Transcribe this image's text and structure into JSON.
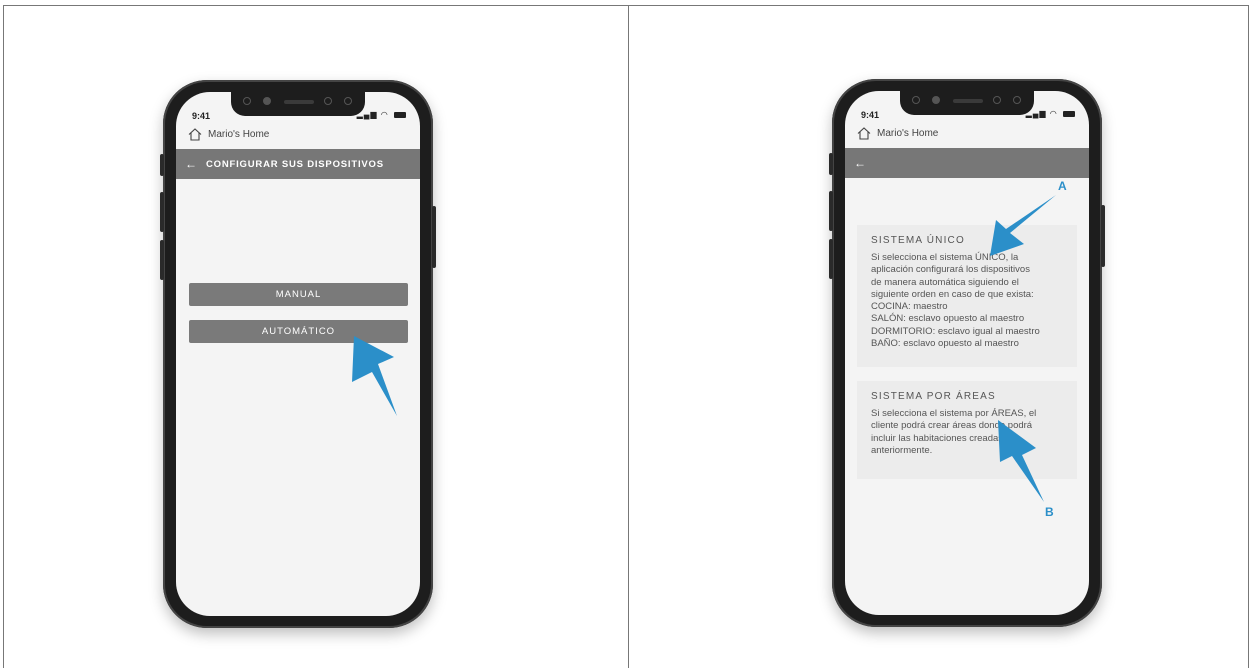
{
  "left_phone": {
    "status_time": "9:41",
    "home_label": "Mario's Home",
    "appbar": {
      "back_icon": "arrow-left-icon",
      "title": "CONFIGURAR SUS DISPOSITIVOS"
    },
    "buttons": {
      "manual": "MANUAL",
      "auto": "AUTOMÁTICO"
    }
  },
  "right_phone": {
    "status_time": "9:41",
    "home_label": "Mario's Home",
    "appbar": {
      "back_icon": "arrow-left-icon"
    },
    "cards": [
      {
        "title": "SISTEMA ÚNICO",
        "lines": [
          "Si selecciona el sistema ÚNICO, la",
          "aplicación configurará los dispositivos",
          "de manera automática siguiendo el",
          "siguiente orden en caso de que exista:",
          "COCINA: maestro",
          "SALÓN: esclavo opuesto al maestro",
          "DORMITORIO: esclavo igual al maestro",
          "BAÑO: esclavo opuesto al maestro"
        ]
      },
      {
        "title": "SISTEMA POR ÁREAS",
        "lines": [
          "Si selecciona el sistema por ÁREAS, el",
          "cliente podrá crear áreas donde podrá",
          "incluir las habitaciones creadas",
          "anteriormente."
        ]
      }
    ],
    "callouts": {
      "a": "A",
      "b": "B"
    }
  },
  "colors": {
    "accent": "#2b8fc9",
    "appbar": "#777777",
    "button": "#7a7a7a",
    "card": "#ececec"
  }
}
